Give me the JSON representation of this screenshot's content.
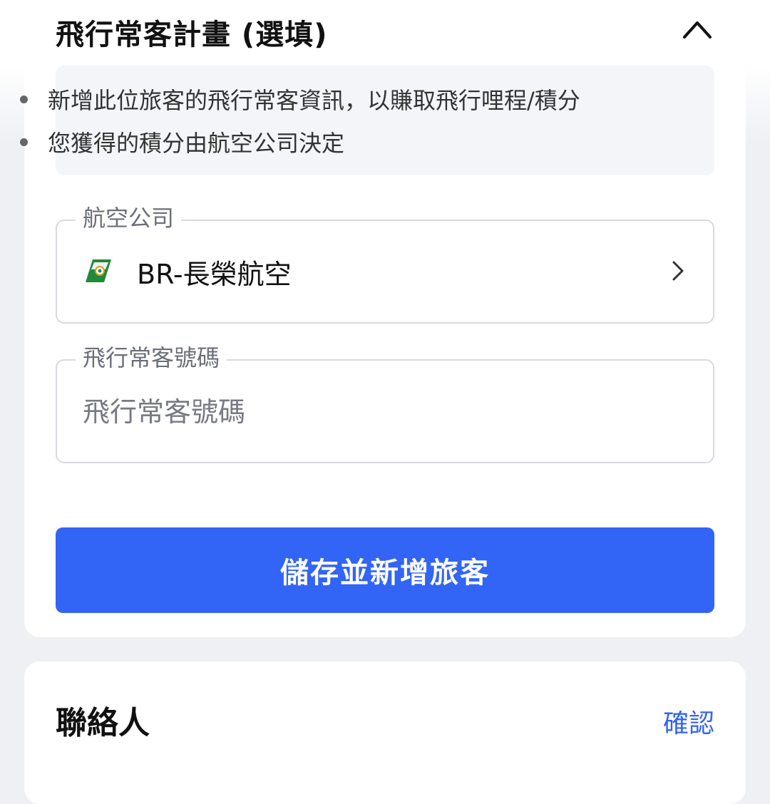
{
  "frequent_flyer": {
    "title": "飛行常客計畫 (選填)",
    "info_items": [
      "新增此位旅客的飛行常客資訊，以賺取飛行哩程/積分",
      "您獲得的積分由航空公司決定"
    ],
    "airline_field": {
      "label": "航空公司",
      "value": "BR-長榮航空",
      "logo_icon": "eva-air-logo-icon",
      "logo_colors": [
        "#1f8a3a",
        "#f2f2f2"
      ]
    },
    "ffn_field": {
      "label": "飛行常客號碼",
      "value": "",
      "placeholder": "飛行常客號碼"
    },
    "save_button_label": "儲存並新增旅客"
  },
  "contact": {
    "title": "聯絡人",
    "confirm_label": "確認"
  },
  "colors": {
    "accent": "#3264f5",
    "page_background": "#eef0f4",
    "card_background": "#ffffff"
  }
}
